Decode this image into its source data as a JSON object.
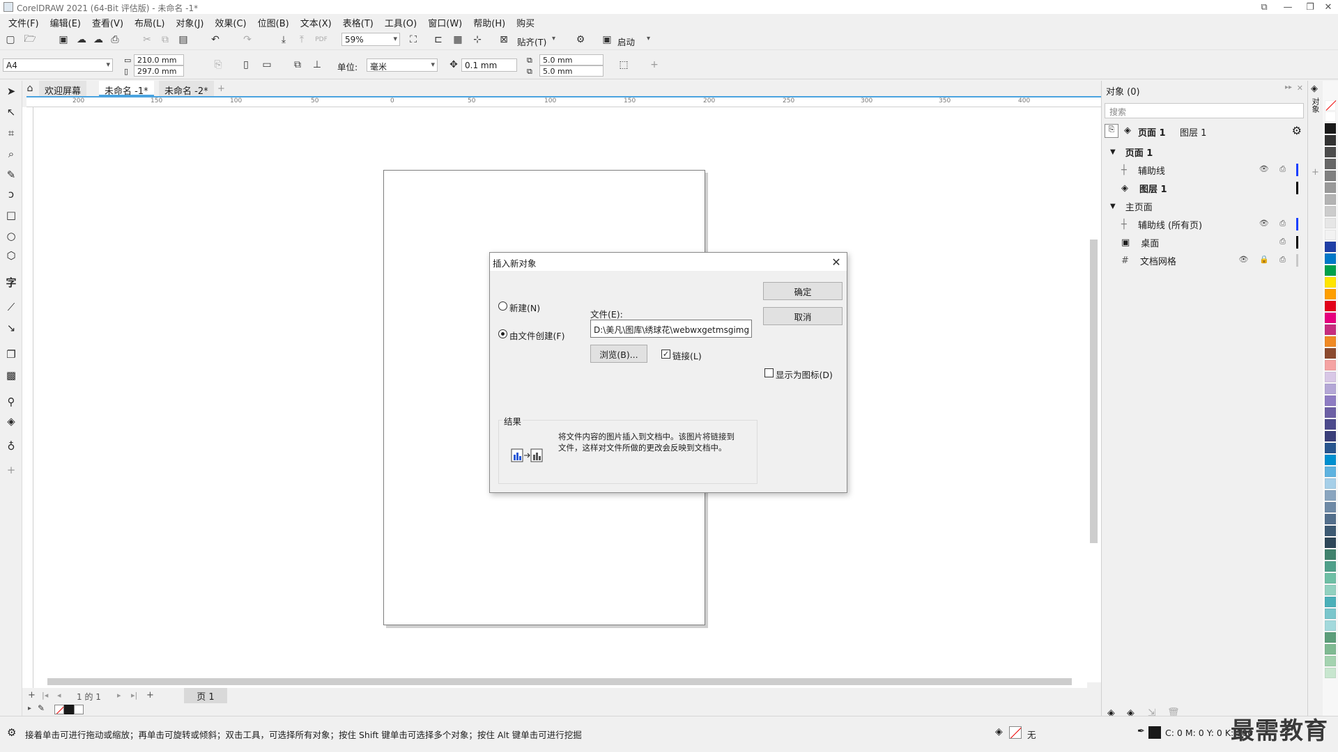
{
  "window": {
    "title": "CorelDRAW 2021 (64-Bit 评估版) - 未命名 -1*",
    "min": "—",
    "restore": "❐",
    "close": "✕",
    "aux": "⧉"
  },
  "menu": [
    "文件(F)",
    "编辑(E)",
    "查看(V)",
    "布局(L)",
    "对象(J)",
    "效果(C)",
    "位图(B)",
    "文本(X)",
    "表格(T)",
    "工具(O)",
    "窗口(W)",
    "帮助(H)",
    "购买"
  ],
  "toolbar": {
    "zoom": "59%",
    "snap_label": "贴齐(T)",
    "launch_label": "启动"
  },
  "propbar": {
    "page_size": "A4",
    "width": "210.0 mm",
    "height": "297.0 mm",
    "units_label": "单位:",
    "units": "毫米",
    "nudge": "0.1 mm",
    "dup_x": "5.0 mm",
    "dup_y": "5.0 mm"
  },
  "tabs": {
    "welcome": "欢迎屏幕",
    "doc1": "未命名 -1*",
    "doc2": "未命名 -2*",
    "add": "+"
  },
  "ruler_h": [
    "200",
    "150",
    "100",
    "50",
    "0",
    "50",
    "100",
    "150",
    "200",
    "250",
    "300",
    "350",
    "400"
  ],
  "pagenav": {
    "counter": "1 的 1",
    "page": "页 1"
  },
  "status": {
    "hint": "接着单击可进行拖动或缩放；再单击可旋转或倾斜；双击工具，可选择所有对象；按住 Shift 键单击可选择多个对象；按住 Alt 键单击可进行挖掘",
    "fill_none": "无",
    "color_readout": "C: 0 M: 0 Y: 0 K: 100"
  },
  "objects_panel": {
    "title": "对象 (0)",
    "search_placeholder": "搜索",
    "header_page": "页面 1",
    "header_layer": "图层 1",
    "rows": [
      {
        "label": "页面 1",
        "kind": "group"
      },
      {
        "label": "辅助线",
        "kind": "layer",
        "color": "#1a3fff"
      },
      {
        "label": "图层 1",
        "kind": "layer-bold",
        "color": "#000000"
      },
      {
        "label": "主页面",
        "kind": "group"
      },
      {
        "label": "辅助线 (所有页)",
        "kind": "layer",
        "color": "#1a3fff"
      },
      {
        "label": "桌面",
        "kind": "layer",
        "color": "#000000"
      },
      {
        "label": "文档网格",
        "kind": "layer",
        "color": "#c8c8c8"
      }
    ]
  },
  "side_tab": "对象",
  "palette": [
    "#ffffff",
    "#1a1a1a",
    "#333333",
    "#4d4d4d",
    "#666666",
    "#808080",
    "#999999",
    "#b3b3b3",
    "#cccccc",
    "#e6e6e6",
    "#f2f2f2",
    "#1f3fa6",
    "#0078c8",
    "#00a14b",
    "#ffe500",
    "#ff9f00",
    "#e2001a",
    "#e6007e",
    "#c72d7f",
    "#f08a24",
    "#8c4a2f",
    "#f5a3a3",
    "#d8c7e6",
    "#b4a7d6",
    "#8e7cc3",
    "#6c5fa5",
    "#4c4a8c",
    "#3b3f7a",
    "#29568f",
    "#0090d0",
    "#5fb3e0",
    "#a6cfe8",
    "#8aa5bf",
    "#6f8aa6",
    "#536f8c",
    "#3d5a73",
    "#2e4759",
    "#40826d",
    "#4fa08a",
    "#6ebfa5",
    "#92d1c0",
    "#4bb0b9",
    "#7ac6cc",
    "#a3d9dc",
    "#5c9e7a",
    "#7fba92",
    "#a4d3b0",
    "#c8e6cf"
  ],
  "dialog": {
    "title": "插入新对象",
    "radio_new": "新建(N)",
    "radio_file": "由文件创建(F)",
    "file_label": "文件(E):",
    "file_value": "D:\\美凡\\图库\\绣球花\\webwxgetmsgimg",
    "browse": "浏览(B)...",
    "link": "链接(L)",
    "ok": "确定",
    "cancel": "取消",
    "display_icon": "显示为图标(D)",
    "result_label": "结果",
    "result_text_1": "将文件内容的图片插入到文档中。该图片将链接到",
    "result_text_2": "文件，这样对文件所做的更改会反映到文档中。"
  },
  "watermark": "最需教育"
}
